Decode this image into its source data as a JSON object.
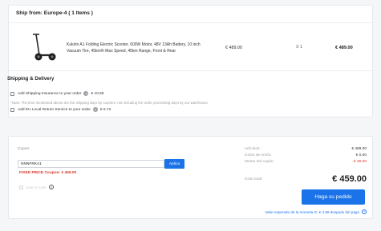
{
  "order": {
    "ship_from": "Ship from: Europe-4 ( 1 Items )",
    "product": {
      "name": "Kukirin A1 Folding Electric Scooter, 600W Motor, 48V 13Ah Battery, 10 inch Vacuum Tire, 45km/h Max Speed, 45km Range, Front & Rear",
      "price": "€ 489.00",
      "qty": "X 1",
      "subtotal": "€ 489.00"
    },
    "shipping_title": "Shipping & Delivery",
    "options": [
      {
        "label": "Add Shipping Insurance to your order",
        "price": "€ 10.66"
      },
      {
        "label": "Add EU Local Return Service to your order",
        "price": "€ 6.72"
      }
    ],
    "note": "*Note: The time mentioned above are the shipping days by couriers, not including the order processing days by our warehouse."
  },
  "coupon": {
    "label": "Cupon:",
    "value": "NNNFRKA1",
    "apply_label": "Aplica",
    "status": "FIXED PRICE Coupon: € 459.00",
    "points_label": "Usar G-code"
  },
  "summary": {
    "rows": [
      {
        "label": "Articulos:",
        "value": "€ 489.00"
      },
      {
        "label": "Costo de envío:",
        "value": "€ 0.00"
      },
      {
        "label": "Monto del cupón:",
        "value": "-€ 30.00"
      }
    ],
    "grand_label": "Gran total:",
    "grand_value": "€ 459.00",
    "order_button": "Haga su pedido",
    "currency_note": "Valor esperado de la moneda G: € 4.59 después del pago"
  },
  "colors": {
    "accent": "#1a73e8",
    "error": "#d9352b"
  }
}
